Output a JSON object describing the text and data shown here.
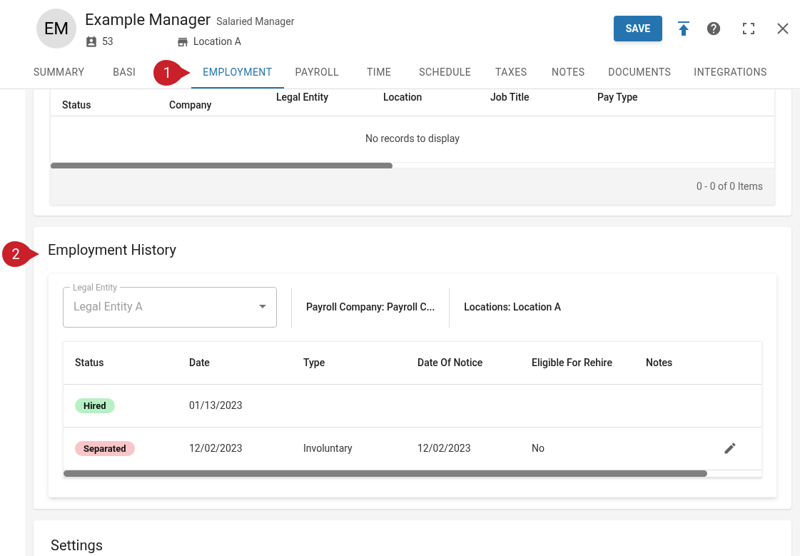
{
  "header": {
    "initials": "EM",
    "name": "Example Manager",
    "role": "Salaried Manager",
    "employee_number": "53",
    "location": "Location A",
    "save_button": "SAVE"
  },
  "tabs": [
    {
      "label": "SUMMARY",
      "selected": false
    },
    {
      "label": "BASI",
      "selected": false
    },
    {
      "label": "EMPLOYMENT",
      "selected": true
    },
    {
      "label": "PAYROLL",
      "selected": false
    },
    {
      "label": "TIME",
      "selected": false
    },
    {
      "label": "SCHEDULE",
      "selected": false
    },
    {
      "label": "TAXES",
      "selected": false
    },
    {
      "label": "NOTES",
      "selected": false
    },
    {
      "label": "DOCUMENTS",
      "selected": false
    },
    {
      "label": "INTEGRATIONS",
      "selected": false
    }
  ],
  "callouts": [
    "1",
    "2"
  ],
  "positions_table": {
    "columns": [
      "Status",
      "Company",
      "Legal Entity",
      "Location",
      "Job Title",
      "Pay Type"
    ],
    "empty_message": "No records to display",
    "pager": "0 - 0 of 0 Items"
  },
  "employment_history": {
    "title": "Employment History",
    "legal_entity": {
      "label": "Legal Entity",
      "value": "Legal Entity A"
    },
    "payroll_company": "Payroll Company: Payroll C...",
    "locations": "Locations: Location A",
    "columns": [
      "Status",
      "Date",
      "Type",
      "Date Of Notice",
      "Eligible For Rehire",
      "Notes"
    ],
    "rows": [
      {
        "status": "Hired",
        "color": "#b7f0c4",
        "date": "01/13/2023",
        "type": "",
        "date_of_notice": "",
        "eligible_for_rehire": "",
        "editable": false
      },
      {
        "status": "Separated",
        "color": "#f8c5c8",
        "date": "12/02/2023",
        "type": "Involuntary",
        "date_of_notice": "12/02/2023",
        "eligible_for_rehire": "No",
        "editable": true
      }
    ]
  },
  "settings": {
    "title": "Settings"
  }
}
